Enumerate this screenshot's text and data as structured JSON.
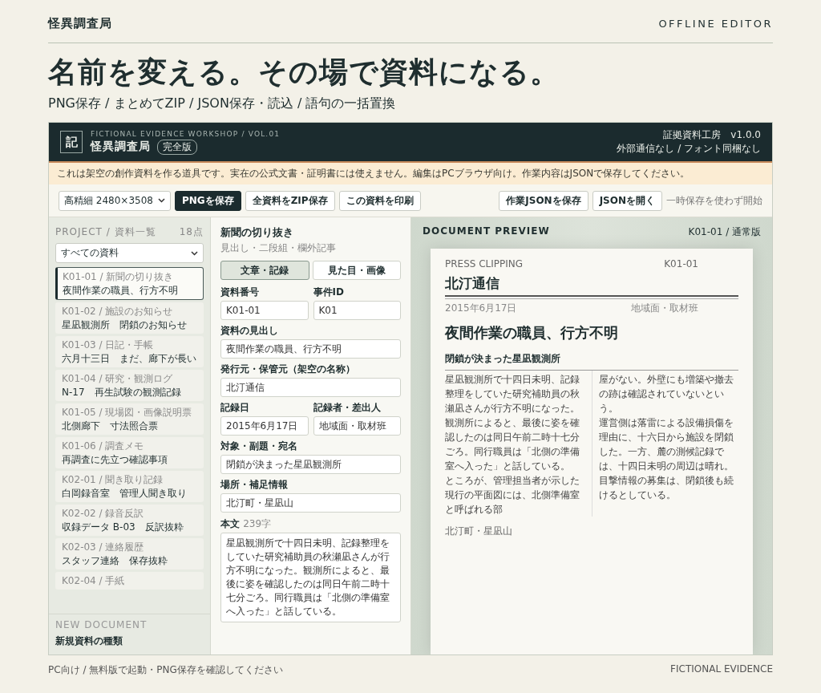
{
  "brand": {
    "name": "怪異調査局",
    "tagline": "OFFLINE EDITOR"
  },
  "hero": {
    "headline": "名前を変える。その場で資料になる。",
    "features": "PNG保存 / まとめてZIP / JSON保存・読込 / 語句の一括置換"
  },
  "app": {
    "header": {
      "logo": "記",
      "eyebrow": "FICTIONAL EVIDENCE WORKSHOP / VOL.01",
      "title": "怪異調査局",
      "badge": "完全版",
      "meta_1": "証拠資料工房　v1.0.0",
      "meta_2": "外部通信なし / フォント同梱なし"
    },
    "notice": "これは架空の創作資料を作る道具です。実在の公式文書・証明書には使えません。編集はPCブラウザ向け。作業内容はJSONで保存してください。",
    "toolbar": {
      "resolution": "高精細 2480×3508",
      "buttons": [
        {
          "label": "PNGを保存",
          "kind": "primary"
        },
        {
          "label": "全資料をZIP保存",
          "kind": "default"
        },
        {
          "label": "この資料を印刷",
          "kind": "default"
        }
      ],
      "right_buttons": [
        {
          "label": "作業JSONを保存",
          "kind": "default"
        },
        {
          "label": "JSONを開く",
          "kind": "default"
        }
      ],
      "hint": "一時保存を使わず開始"
    },
    "sidebar": {
      "heading": "PROJECT / 資料一覧",
      "count": "18点",
      "filter": "すべての資料",
      "items": [
        {
          "meta": "K01-01 / 新聞の切り抜き",
          "title": "夜間作業の職員、行方不明",
          "selected": true
        },
        {
          "meta": "K01-02 / 施設のお知らせ",
          "title": "星凪観測所　閉鎖のお知らせ",
          "selected": false
        },
        {
          "meta": "K01-03 / 日記・手帳",
          "title": "六月十三日　まだ、廊下が長い",
          "selected": false
        },
        {
          "meta": "K01-04 / 研究・観測ログ",
          "title": "N-17　再生試験の観測記録",
          "selected": false
        },
        {
          "meta": "K01-05 / 現場図・画像説明票",
          "title": "北側廊下　寸法照合票",
          "selected": false
        },
        {
          "meta": "K01-06 / 調査メモ",
          "title": "再調査に先立つ確認事項",
          "selected": false
        },
        {
          "meta": "K02-01 / 聞き取り記録",
          "title": "白岡録音室　管理人聞き取り",
          "selected": false
        },
        {
          "meta": "K02-02 / 録音反訳",
          "title": "収録データ B-03　反訳抜粋",
          "selected": false
        },
        {
          "meta": "K02-03 / 連絡履歴",
          "title": "スタッフ連絡　保存抜粋",
          "selected": false
        },
        {
          "meta": "K02-04 / 手紙",
          "selected": false
        }
      ],
      "new_heading": "NEW DOCUMENT",
      "new_label": "新規資料の種類"
    },
    "editor": {
      "title": "新聞の切り抜き",
      "subtitle": "見出し・二段組・欄外記事",
      "tabs": [
        {
          "label": "文章・記録",
          "selected": true
        },
        {
          "label": "見た目・画像",
          "selected": false
        }
      ],
      "field_rows": [
        [
          {
            "label": "資料番号",
            "value": "K01-01"
          },
          {
            "label": "事件ID",
            "value": "K01"
          }
        ],
        [
          {
            "label": "資料の見出し",
            "value": "夜間作業の職員、行方不明"
          }
        ],
        [
          {
            "label": "発行元・保管元（架空の名称）",
            "value": "北汀通信"
          }
        ],
        [
          {
            "label": "記録日",
            "value": "2015年6月17日"
          },
          {
            "label": "記録者・差出人",
            "value": "地域面・取材班"
          }
        ],
        [
          {
            "label": "対象・副題・宛名",
            "value": "閉鎖が決まった星凪観測所"
          }
        ],
        [
          {
            "label": "場所・補足情報",
            "value": "北汀町・星凪山"
          }
        ]
      ],
      "body": {
        "label": "本文",
        "count": "239字",
        "value": "星凪観測所で十四日未明、記録整理をしていた研究補助員の秋瀬凪さんが行方不明になった。観測所によると、最後に姿を確認したのは同日午前二時十七分ごろ。同行職員は「北側の準備室へ入った」と話している。"
      }
    },
    "preview": {
      "heading": "DOCUMENT PREVIEW",
      "version": "K01-01 / 通常版",
      "document": {
        "kicker": "PRESS CLIPPING",
        "id": "K01-01",
        "masthead": "北汀通信",
        "date": "2015年6月17日",
        "desk": "地域面・取材班",
        "headline": "夜間作業の職員、行方不明",
        "subhead": "閉鎖が決まった星凪観測所",
        "columns": [
          [
            "星凪観測所で十四日未明、記録整理をしていた研究補助員の秋瀬凪さんが行方不明になった。観測所によると、最後に姿を確認したのは同日午前二時十七分ごろ。同行職員は「北側の準備室へ入った」と話している。",
            "ところが、管理担当者が示した現行の平面図には、北側準備室と呼ばれる部"
          ],
          [
            "屋がない。外壁にも増築や撤去の跡は確認されていないという。",
            "運営側は落雷による設備損傷を理由に、十六日から施設を閉鎖した。一方、麓の測候記録では、十四日未明の周辺は晴れ。目撃情報の募集は、閉鎖後も続けるとしている。"
          ]
        ],
        "footer": "北汀町・星凪山"
      }
    }
  },
  "footer": {
    "left": "PC向け / 無料版で起動・PNG保存を確認してください",
    "right": "FICTIONAL EVIDENCE"
  }
}
